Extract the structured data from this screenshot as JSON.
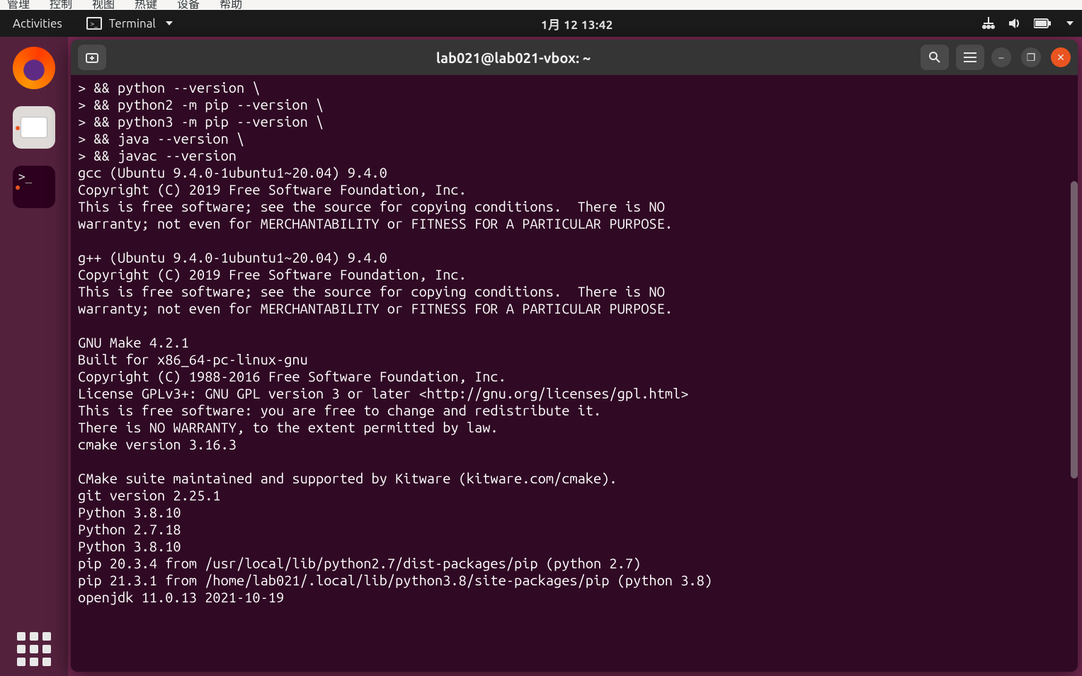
{
  "vm_menu": {
    "items": [
      "管理",
      "控制",
      "视图",
      "热键",
      "设备",
      "帮助"
    ]
  },
  "topbar": {
    "activities": "Activities",
    "app_name": "Terminal",
    "app_icon": "terminal-icon",
    "clock": "1月 12 13:42",
    "status_icons": [
      "network-icon",
      "volume-icon",
      "battery-icon"
    ]
  },
  "dock": {
    "items": [
      {
        "name": "firefox-icon",
        "running": false
      },
      {
        "name": "files-icon",
        "running": true
      },
      {
        "name": "terminal-icon",
        "running": true
      }
    ],
    "apps_grid": "show-applications-icon"
  },
  "terminal_window": {
    "new_tab_tooltip": "New Tab",
    "search_tooltip": "Search",
    "menu_tooltip": "Menu",
    "title": "lab021@lab021-vbox: ~",
    "controls": {
      "minimize": "–",
      "maximize": "❐",
      "close": "✕"
    },
    "lines": [
      "> && python --version \\",
      "> && python2 -m pip --version \\",
      "> && python3 -m pip --version \\",
      "> && java --version \\",
      "> && javac --version",
      "gcc (Ubuntu 9.4.0-1ubuntu1~20.04) 9.4.0",
      "Copyright (C) 2019 Free Software Foundation, Inc.",
      "This is free software; see the source for copying conditions.  There is NO",
      "warranty; not even for MERCHANTABILITY or FITNESS FOR A PARTICULAR PURPOSE.",
      "",
      "g++ (Ubuntu 9.4.0-1ubuntu1~20.04) 9.4.0",
      "Copyright (C) 2019 Free Software Foundation, Inc.",
      "This is free software; see the source for copying conditions.  There is NO",
      "warranty; not even for MERCHANTABILITY or FITNESS FOR A PARTICULAR PURPOSE.",
      "",
      "GNU Make 4.2.1",
      "Built for x86_64-pc-linux-gnu",
      "Copyright (C) 1988-2016 Free Software Foundation, Inc.",
      "License GPLv3+: GNU GPL version 3 or later <http://gnu.org/licenses/gpl.html>",
      "This is free software: you are free to change and redistribute it.",
      "There is NO WARRANTY, to the extent permitted by law.",
      "cmake version 3.16.3",
      "",
      "CMake suite maintained and supported by Kitware (kitware.com/cmake).",
      "git version 2.25.1",
      "Python 3.8.10",
      "Python 2.7.18",
      "Python 3.8.10",
      "pip 20.3.4 from /usr/local/lib/python2.7/dist-packages/pip (python 2.7)",
      "pip 21.3.1 from /home/lab021/.local/lib/python3.8/site-packages/pip (python 3.8)",
      "openjdk 11.0.13 2021-10-19"
    ]
  },
  "colors": {
    "terminal_bg": "#300a24",
    "terminal_fg": "#ffffff",
    "ubuntu_orange": "#e95420",
    "topbar_bg": "#1b1b1b"
  }
}
